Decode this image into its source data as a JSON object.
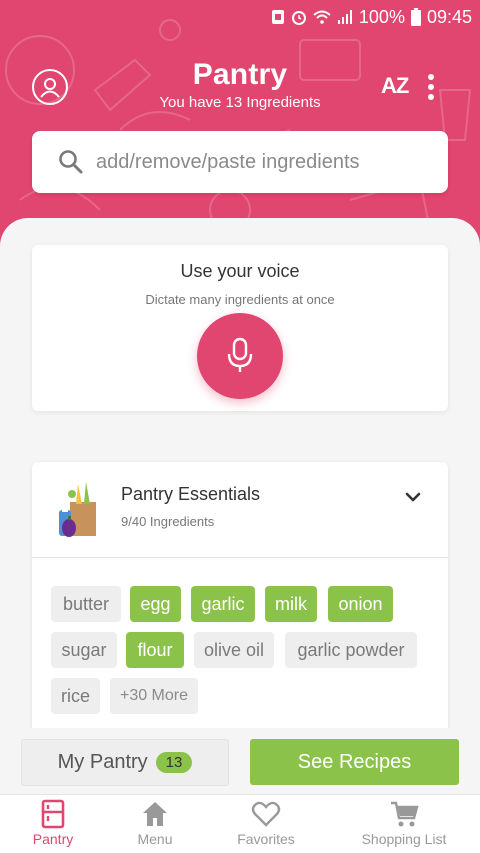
{
  "status_bar": {
    "battery": "100%",
    "time": "09:45"
  },
  "header": {
    "title": "Pantry",
    "subtitle": "You have 13 Ingredients",
    "sort_label": "AZ",
    "icons": [
      "profile-icon",
      "sort-az-icon",
      "more-vert-icon"
    ]
  },
  "search": {
    "placeholder": "add/remove/paste ingredients",
    "value": ""
  },
  "voice": {
    "title": "Use your voice",
    "subtitle": "Dictate many ingredients at once",
    "icon": "microphone-icon"
  },
  "essentials": {
    "title": "Pantry Essentials",
    "count": "9/40 Ingredients",
    "chips": [
      {
        "label": "butter",
        "selected": false
      },
      {
        "label": "egg",
        "selected": true
      },
      {
        "label": "garlic",
        "selected": true
      },
      {
        "label": "milk",
        "selected": true
      },
      {
        "label": "onion",
        "selected": true
      },
      {
        "label": "sugar",
        "selected": false
      },
      {
        "label": "flour",
        "selected": true
      },
      {
        "label": "olive oil",
        "selected": false
      },
      {
        "label": "garlic powder",
        "selected": false
      },
      {
        "label": "rice",
        "selected": false
      }
    ],
    "more_label": "+30 More"
  },
  "actions": {
    "my_pantry": "My Pantry",
    "pantry_count": "13",
    "see_recipes": "See Recipes"
  },
  "nav": [
    {
      "label": "Pantry",
      "icon": "pantry-icon",
      "active": true
    },
    {
      "label": "Menu",
      "icon": "home-icon",
      "active": false
    },
    {
      "label": "Favorites",
      "icon": "heart-icon",
      "active": false
    },
    {
      "label": "Shopping List",
      "icon": "cart-icon",
      "active": false
    }
  ],
  "colors": {
    "accent": "#e0466f",
    "green": "#8bc34a",
    "chip_off": "#eeeeee"
  }
}
